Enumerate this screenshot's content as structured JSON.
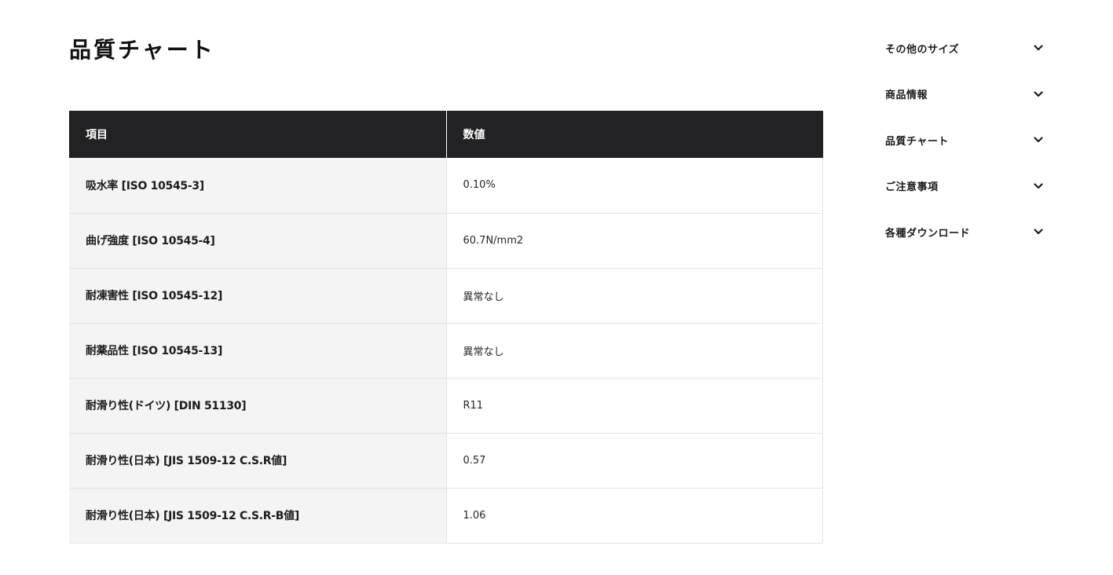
{
  "main": {
    "title": "品質チャート",
    "table": {
      "headers": [
        "項目",
        "数値"
      ],
      "rows": [
        {
          "item": "吸水率 [ISO 10545-3]",
          "value": "0.10%"
        },
        {
          "item": "曲げ強度 [ISO 10545-4]",
          "value": "60.7N/mm2"
        },
        {
          "item": "耐凍害性 [ISO 10545-12]",
          "value": "異常なし"
        },
        {
          "item": "耐薬品性 [ISO 10545-13]",
          "value": "異常なし"
        },
        {
          "item": "耐滑り性(ドイツ) [DIN 51130]",
          "value": "R11"
        },
        {
          "item": "耐滑り性(日本) [JIS 1509-12 C.S.R値]",
          "value": "0.57"
        },
        {
          "item": "耐滑り性(日本) [JIS 1509-12 C.S.R-B値]",
          "value": "1.06"
        }
      ]
    }
  },
  "sidebar": {
    "items": [
      {
        "label": "その他のサイズ",
        "icon": "chevron-down-icon"
      },
      {
        "label": "商品情報",
        "icon": "chevron-down-icon"
      },
      {
        "label": "品質チャート",
        "icon": "chevron-down-icon"
      },
      {
        "label": "ご注意事項",
        "icon": "chevron-down-icon"
      },
      {
        "label": "各種ダウンロード",
        "icon": "chevron-down-icon"
      }
    ]
  },
  "colors": {
    "header_bg": "#222225",
    "item_cell_bg": "#f4f4f4",
    "border": "#e4e4e4",
    "text": "#1c1c1c"
  }
}
